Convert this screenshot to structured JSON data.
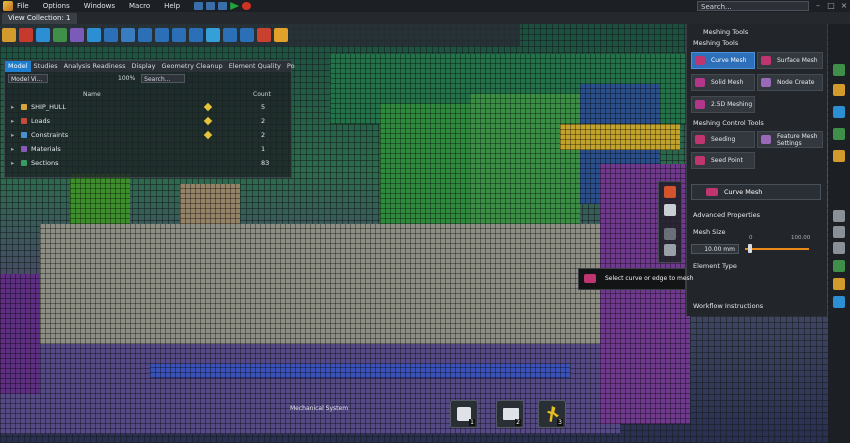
{
  "menubar": {
    "items": [
      "File",
      "Options",
      "Windows",
      "Macro",
      "Help"
    ],
    "search_placeholder": "Search..."
  },
  "tabs": {
    "view_collection": "View Collection: 1"
  },
  "model_browser": {
    "tabs": [
      "Model",
      "Studies",
      "Analysis Readiness",
      "Display",
      "Geometry Cleanup",
      "Element Quality",
      "Po"
    ],
    "view_select": "Model Vi...",
    "zoom": "100%",
    "search_placeholder": "Search...",
    "col_name": "Name",
    "col_count": "Count",
    "rows": [
      {
        "label": "SHIP_HULL",
        "count": "5"
      },
      {
        "label": "Loads",
        "count": "2"
      },
      {
        "label": "Constraints",
        "count": "2"
      },
      {
        "label": "Materials",
        "count": "1"
      },
      {
        "label": "Sections",
        "count": "83"
      }
    ]
  },
  "meshing_panel": {
    "header": "Meshing Tools",
    "section_tools": "Meshing Tools",
    "buttons": {
      "curve_mesh": "Curve Mesh",
      "surface_mesh": "Surface Mesh",
      "solid_mesh": "Solid Mesh",
      "node_create": "Node Create",
      "meshing_25d": "2.5D Meshing"
    },
    "section_control": "Meshing Control Tools",
    "control_buttons": {
      "seeding": "Seeding",
      "feature_mesh": "Feature Mesh Settings",
      "seed_point": "Seed Point"
    },
    "curve_mesh_title": "Curve Mesh",
    "advanced": "Advanced Properties",
    "mesh_size_label": "Mesh Size",
    "mesh_size_value": "10.00 mm",
    "slider_min": "0",
    "slider_max": "100.00",
    "slider_value": 0.05,
    "element_type_label": "Element Type",
    "workflow": "Workflow Instructions"
  },
  "tooltip": {
    "text": "Select curve or edge to mesh"
  },
  "dock": {
    "label": "Mechanical System",
    "buttons": [
      {
        "icon": "checklist-icon",
        "num": "1"
      },
      {
        "icon": "book-icon",
        "num": "2"
      },
      {
        "icon": "runner-icon",
        "num": "3"
      }
    ]
  },
  "colors": {
    "accent": "#2d6fb8",
    "slider": "#e88a1a",
    "curve_mesh_icon": "#c0356f"
  }
}
